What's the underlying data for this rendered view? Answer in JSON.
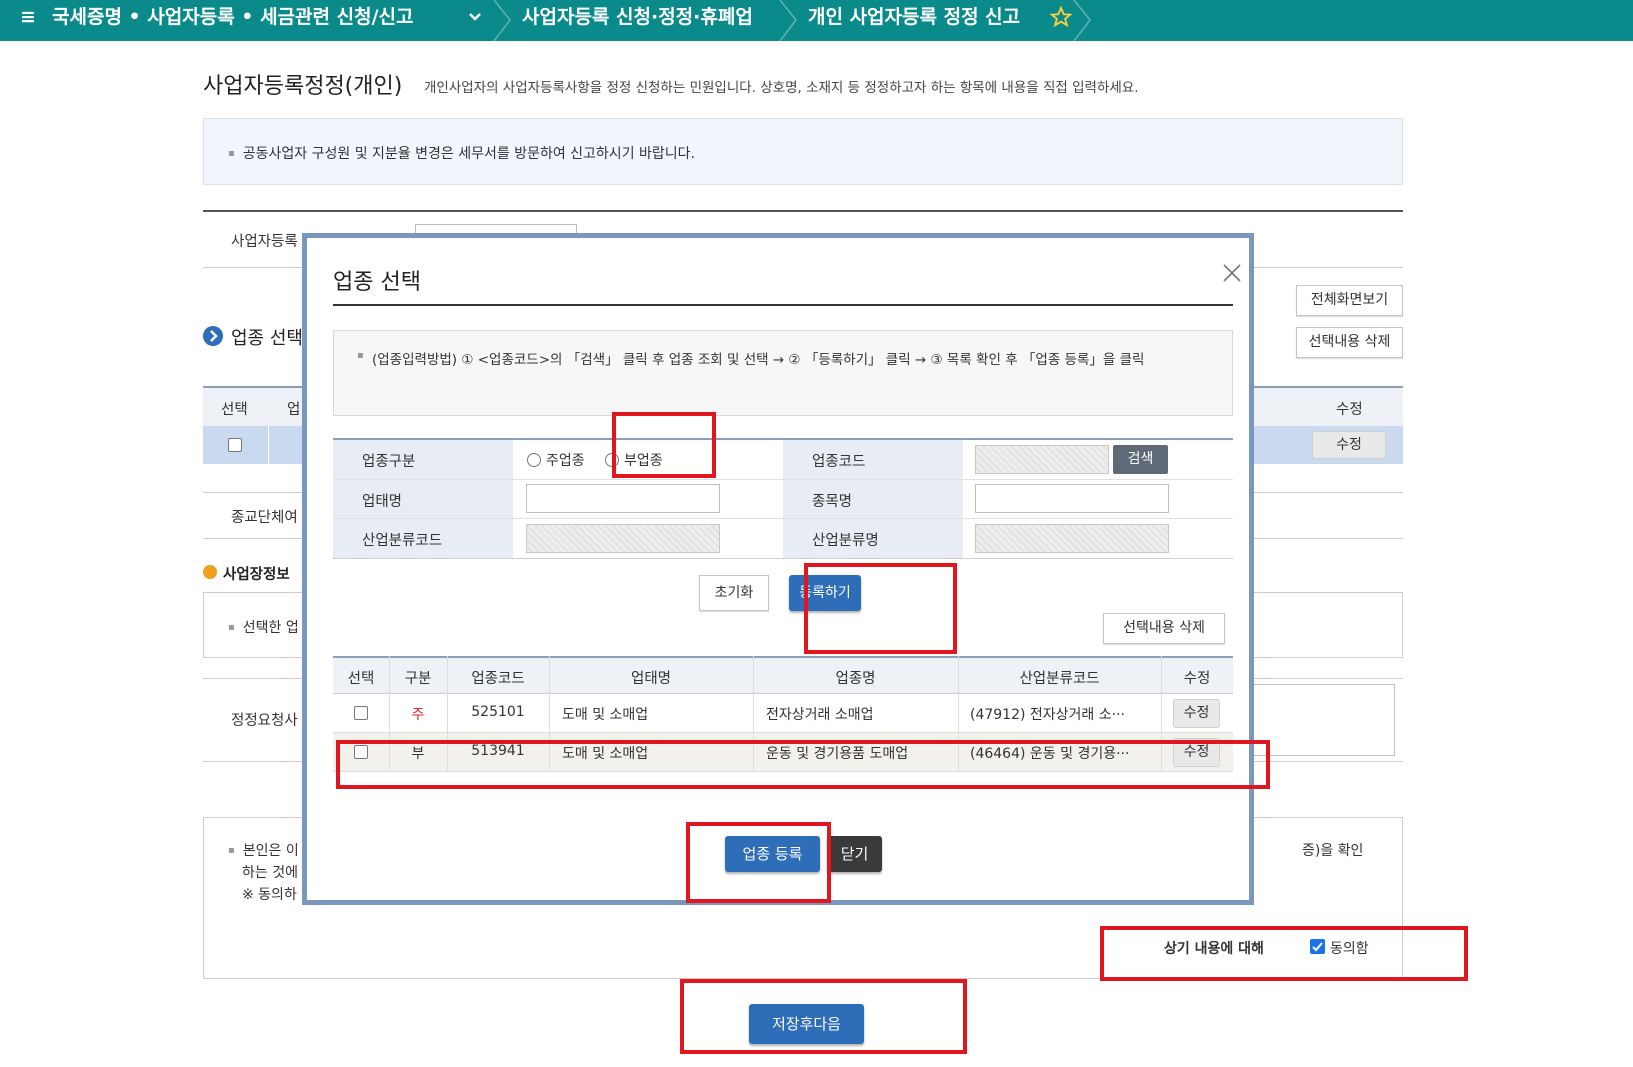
{
  "nav": {
    "menu_label": "국세증명 • 사업자등록 • 세금관련 신청/신고",
    "crumb2": "사업자등록 신청·정정·휴폐업",
    "crumb3": "개인 사업자등록 정정 신고"
  },
  "page": {
    "title": "사업자등록정정(개인)",
    "description": "개인사업자의 사업자등록사항을 정정 신청하는 민원입니다. 상호명, 소재지 등 정정하고자 하는 항목에 내용을 직접 입력하세요.",
    "notice": "공동사업자 구성원 및 지분율 변경은 세무서를 방문하여 신고하시기 바랍니다.",
    "bizno_label": "사업자등록",
    "fullscreen_btn": "전체화면보기",
    "industry_section": "업종 선택",
    "delete_selected_btn": "선택내용 삭제",
    "col_select": "선택",
    "col_industry_cut": "업",
    "col_edit": "수정",
    "edit_btn": "수정",
    "religion_label": "종교단체여",
    "workplace_section": "사업장정보",
    "workplace_note": "선택한 업",
    "correction_label": "정정요청사",
    "consent_text_1": "본인은 이",
    "consent_text_1_tail": "증)을 확인",
    "consent_text_2": "하는 것에",
    "consent_text_3": "※ 동의하",
    "consent_question": "상기 내용에 대해",
    "consent_label": "동의함",
    "consent_checked": true,
    "save_next_btn": "저장후다음"
  },
  "modal": {
    "title": "업종 선택",
    "guide": "(업종입력방법) ① <업종코드>의 「검색」 클릭 후 업종 조회 및 선택 → ② 「등록하기」 클릭 → ③ 목록 확인 후 「업종 등록」을 클릭",
    "form": {
      "type_label": "업종구분",
      "main_option": "주업종",
      "sub_option": "부업종",
      "code_label": "업종코드",
      "search_btn": "검색",
      "biztype_label": "업태명",
      "item_label": "종목명",
      "class_code_label": "산업분류코드",
      "class_name_label": "산업분류명"
    },
    "reset_btn": "초기화",
    "register_btn": "등록하기",
    "delete_selected_btn": "선택내용 삭제",
    "table": {
      "headers": [
        "선택",
        "구분",
        "업종코드",
        "업태명",
        "업종명",
        "산업분류코드",
        "수정"
      ],
      "rows": [
        {
          "type": "주",
          "code": "525101",
          "biztype": "도매 및 소매업",
          "name": "전자상거래 소매업",
          "class": "(47912) 전자상거래 소···",
          "edit": "수정"
        },
        {
          "type": "부",
          "code": "513941",
          "biztype": "도매 및 소매업",
          "name": "운동 및 경기용품 도매업",
          "class": "(46464) 운동 및 경기용···",
          "edit": "수정"
        }
      ]
    },
    "confirm_btn": "업종 등록",
    "close_btn": "닫기"
  },
  "colors": {
    "nav_bg": "#0b8a8b",
    "accent_blue": "#2e6db7",
    "annotation_red": "#e0171f",
    "modal_border": "#7b97bf"
  }
}
